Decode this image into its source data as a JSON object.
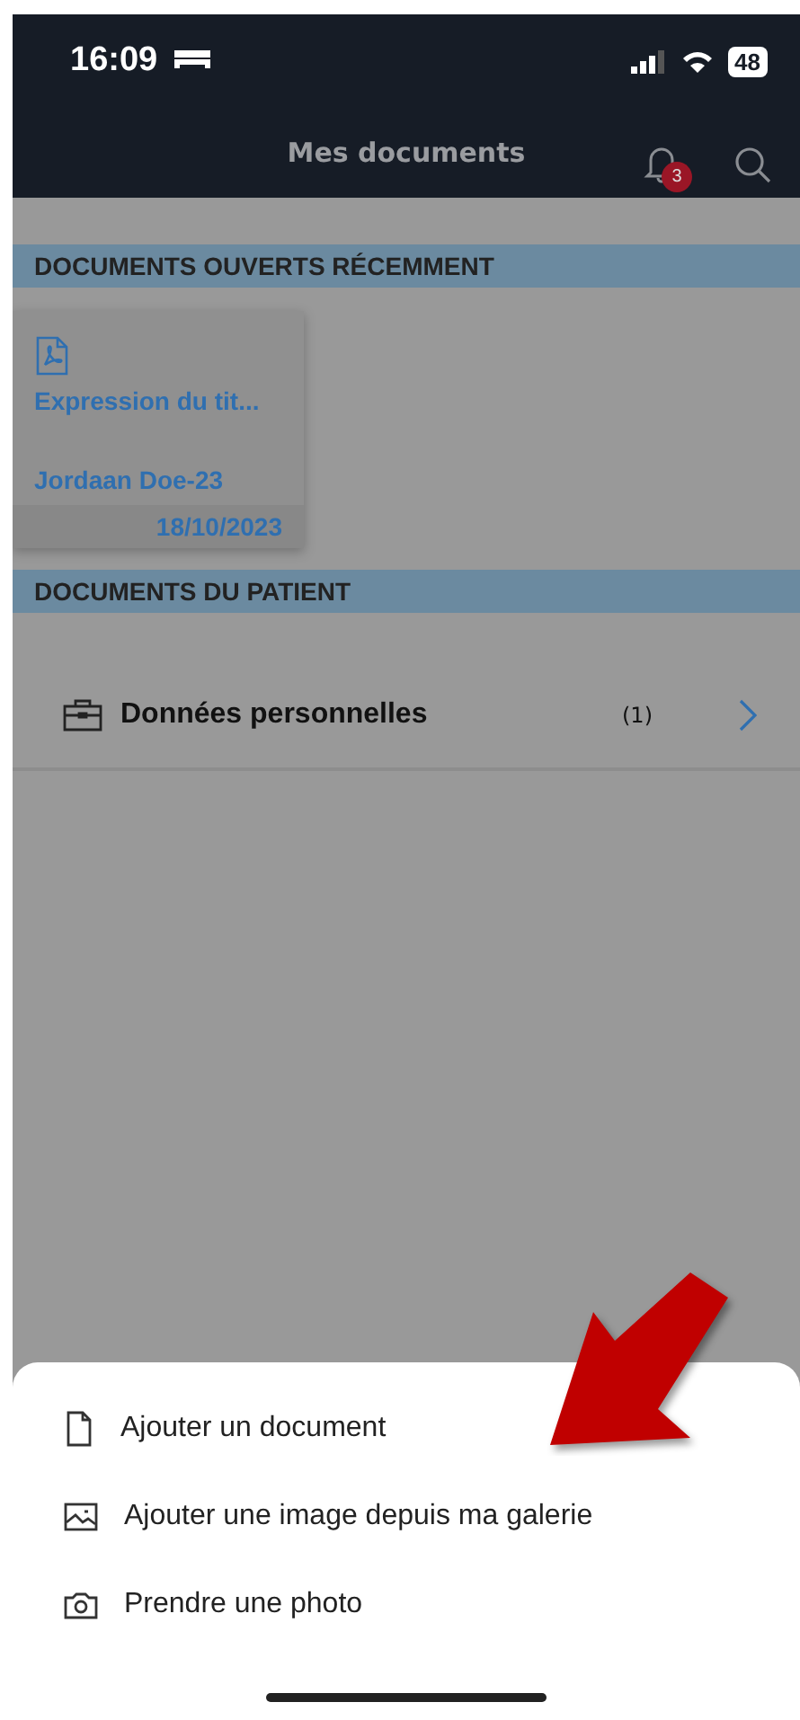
{
  "status_bar": {
    "time": "16:09",
    "battery": "48"
  },
  "header": {
    "title": "Mes documents",
    "notification_count": "3"
  },
  "sections": [
    {
      "kind": "recent",
      "title": "DOCUMENTS OUVERTS RÉCEMMENT",
      "cards": [
        {
          "title": "Expression du tit...",
          "patient": "Jordaan Doe-23",
          "date": "18/10/2023"
        }
      ]
    },
    {
      "kind": "folders",
      "title": "DOCUMENTS DU PATIENT",
      "rows": [
        {
          "label": "Données personnelles",
          "count": "(1)"
        }
      ]
    }
  ],
  "sheet": {
    "actions": [
      {
        "kind": "document",
        "label": "Ajouter un document"
      },
      {
        "kind": "gallery",
        "label": "Ajouter une image depuis ma galerie"
      },
      {
        "kind": "camera",
        "label": "Prendre une photo"
      }
    ]
  }
}
